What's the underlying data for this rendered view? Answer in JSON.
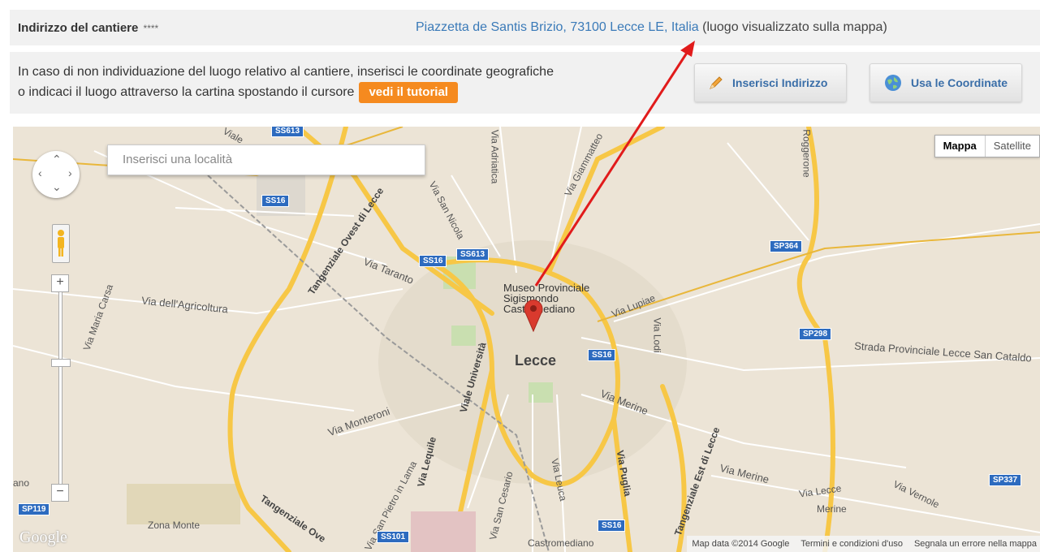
{
  "address": {
    "label": "Indirizzo del cantiere",
    "required_marker": "****",
    "value_link": "Piazzetta de Santis Brizio, 73100 Lecce LE, Italia",
    "value_note": "(luogo visualizzato sulla mappa)"
  },
  "info": {
    "line1": "In caso di non individuazione del luogo relativo al cantiere, inserisci le coordinate geografiche",
    "line2": "o indicaci il luogo attraverso la cartina spostando il cursore",
    "tutorial_label": "vedi il tutorial"
  },
  "buttons": {
    "insert_address": "Inserisci Indirizzo",
    "use_coordinates": "Usa le Coordinate",
    "insert_icon": "pencil-icon",
    "coord_icon": "globe-icon"
  },
  "map": {
    "search_placeholder": "Inserisci una località",
    "maptype_map": "Mappa",
    "maptype_satellite": "Satellite",
    "city": "Lecce",
    "museum_lines": [
      "Museo Provinciale",
      "Sigismondo",
      "Castromediano"
    ],
    "labels": {
      "viale_top": "Viale",
      "via_adriatica": "Via Adriatica",
      "via_giammatteo": "Via Giammatteo",
      "roggerone": "Roggerone",
      "via_san_nicola": "Via San Nicola",
      "tangenziale_ovest": "Tangenziale Ovest di Lecce",
      "via_taranto": "Via Taranto",
      "via_agricoltura": "Via dell'Agricoltura",
      "via_maria_carsa": "Via Maria Carsa",
      "viale_universita": "Viale Università",
      "via_lupiae": "Via Lupiae",
      "via_lodi": "Via Lodi",
      "strada_provinciale": "Strada Provinciale Lecce San Cataldo",
      "via_monteroni": "Via Monteroni",
      "via_merine": "Via Merine",
      "via_merine_2": "Via Merine",
      "via_lecce": "Via Lecce",
      "merine": "Merine",
      "via_vernole": "Via Vernole",
      "via_lequile": "Via Lequile",
      "via_san_pietro": "Via San Pietro in Lama",
      "via_san_cesario": "Via San Cesario",
      "via_leuca": "Via Leuca",
      "via_puglia": "Via Puglia",
      "tangenziale_est": "Tangenziale Est di Lecce",
      "tangenziale_ovest_2": "Tangenziale Ove",
      "zona_monte": "Zona Monte",
      "castromediano": "Castromediano",
      "ano": "ano"
    },
    "badges": {
      "ss613_top": "SS613",
      "ss16_left": "SS16",
      "ss16_mid": "SS16",
      "ss613_mid": "SS613",
      "sp364": "SP364",
      "sp298": "SP298",
      "ss16_center": "SS16",
      "sp337": "SP337",
      "sp119": "SP119",
      "ss101": "SS101",
      "ss16_bottom": "SS16"
    },
    "google": "Google",
    "attrib_data": "Map data ©2014 Google",
    "attrib_terms": "Termini e condizioni d'uso",
    "attrib_report": "Segnala un errore nella mappa",
    "marker_color": "#d93a2e"
  },
  "colors": {
    "accent": "#f58a1f",
    "link": "#3a7ab8",
    "arrow": "#e11b1b",
    "road_major": "#f7c746",
    "badge": "#2d6bbf"
  }
}
